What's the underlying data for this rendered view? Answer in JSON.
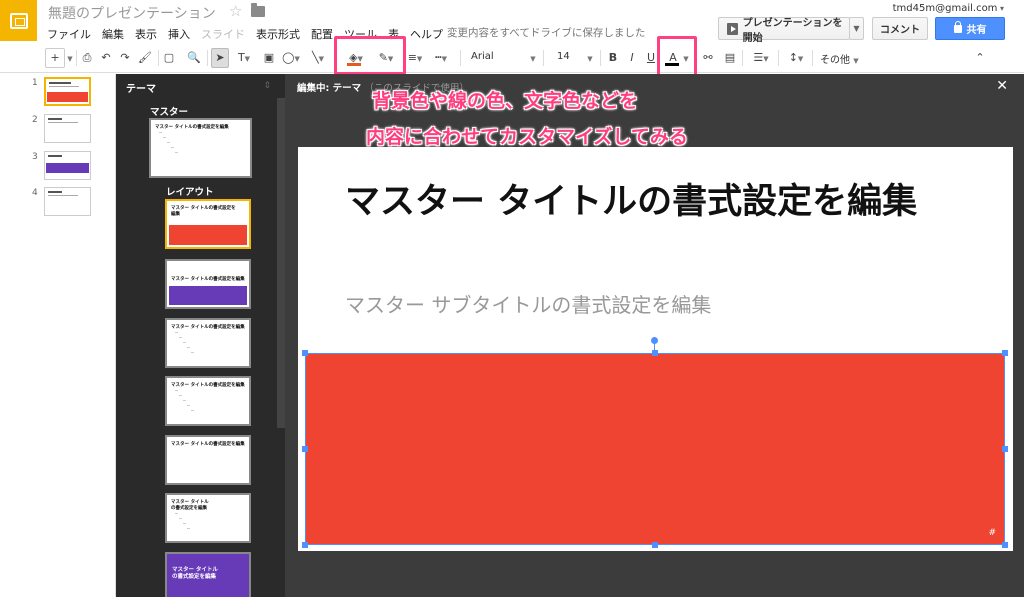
{
  "header": {
    "doc_title": "無題のプレゼンテーション",
    "menu": [
      "ファイル",
      "編集",
      "表示",
      "挿入",
      "スライド",
      "表示形式",
      "配置",
      "ツール",
      "表",
      "ヘルプ"
    ],
    "save_status": "変更内容をすべてドライブに保存しました",
    "user_email": "tmd45m@gmail.com",
    "present_label": "プレゼンテーションを開始",
    "comment_label": "コメント",
    "share_label": "共有"
  },
  "toolbar": {
    "font": "Arial",
    "size": "14",
    "bold": "B",
    "italic": "I",
    "underline": "U",
    "text_color": "A",
    "other": "その他",
    "fill_color": "#e45a1f"
  },
  "filmstrip": {
    "slides": [
      "1",
      "2",
      "3",
      "4"
    ]
  },
  "theme_panel": {
    "title": "テーマ",
    "master_label": "マスター",
    "layout_label": "レイアウト",
    "master_thumb_title": "マスター タイトルの書式設定を編集",
    "layout_title_1": "マスター タイトルの書式設定を",
    "layout_title_1b": "編集",
    "layout_title_2": "マスター タイトルの書式設定を編集",
    "layout_title_6a": "マスター タイトル",
    "layout_title_6b": "の書式設定を編集",
    "layout_title_7a": "マスター タイトル",
    "layout_title_7b": "の書式設定を編集"
  },
  "editor": {
    "header_main": "編集中: テーマ",
    "header_dim": "（このスライドで使用）",
    "slide_title": "マスター タイトルの書式設定を編集",
    "slide_subtitle": "マスター サブタイトルの書式設定を編集",
    "page_number": "#"
  },
  "annotation": {
    "line1": "背景色や線の色、文字色などを",
    "line2": "内容に合わせてカスタマイズしてみる"
  },
  "colors": {
    "accent_yellow": "#f4b400",
    "shape_red": "#ef4431",
    "layout_purple": "#673ab7",
    "share_blue": "#4d90fe",
    "highlight_pink": "#ff4081"
  }
}
